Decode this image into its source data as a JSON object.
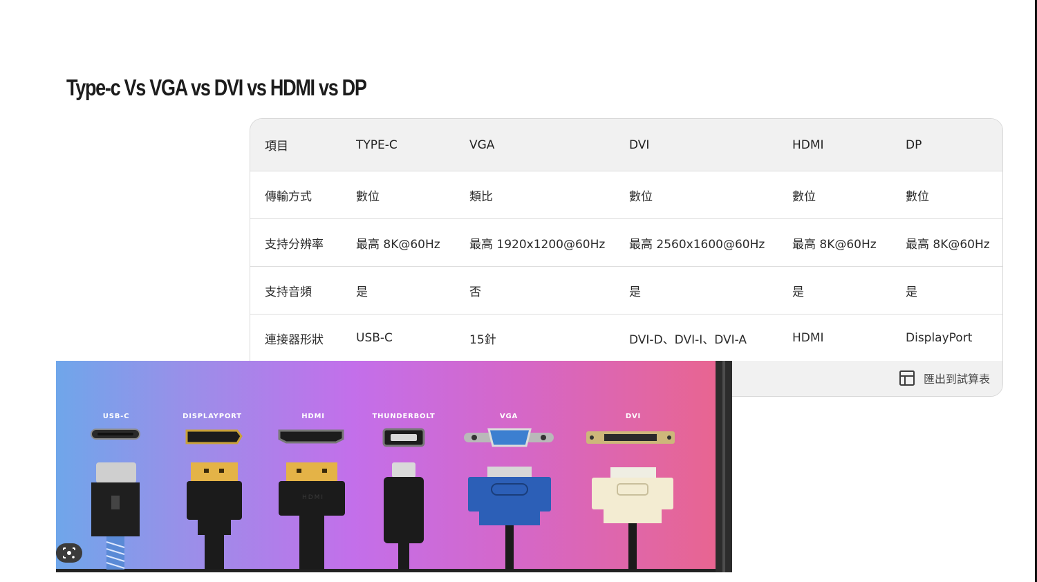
{
  "slide": {
    "title": "Type-c Vs VGA vs DVI vs HDMI vs DP"
  },
  "table": {
    "headers": [
      "項目",
      "TYPE-C",
      "VGA",
      "DVI",
      "HDMI",
      "DP"
    ],
    "rows": [
      [
        "傳輸方式",
        "數位",
        "類比",
        "數位",
        "數位",
        "數位"
      ],
      [
        "支持分辨率",
        "最高 8K@60Hz",
        "最高 1920x1200@60Hz",
        "最高 2560x1600@60Hz",
        "最高 8K@60Hz",
        "最高 8K@60Hz"
      ],
      [
        "支持音頻",
        "是",
        "否",
        "是",
        "是",
        "是"
      ],
      [
        "連接器形狀",
        "USB-C",
        "15針",
        "DVI-D、DVI-I、DVI-A",
        "HDMI",
        "DisplayPort"
      ]
    ],
    "export_label": "匯出到試算表",
    "export_icon": "table-grid-icon"
  },
  "photo": {
    "connector_labels": [
      "USB-C",
      "DISPLAYPORT",
      "HDMI",
      "THUNDERBOLT",
      "VGA",
      "DVI"
    ],
    "plug_text": "HDMI",
    "lens_icon": "google-lens-icon"
  },
  "colors": {
    "header_bg": "#f1f1f1",
    "gradient_start": "#6fa6ea",
    "gradient_mid": "#c36fea",
    "gradient_end": "#e86591"
  }
}
